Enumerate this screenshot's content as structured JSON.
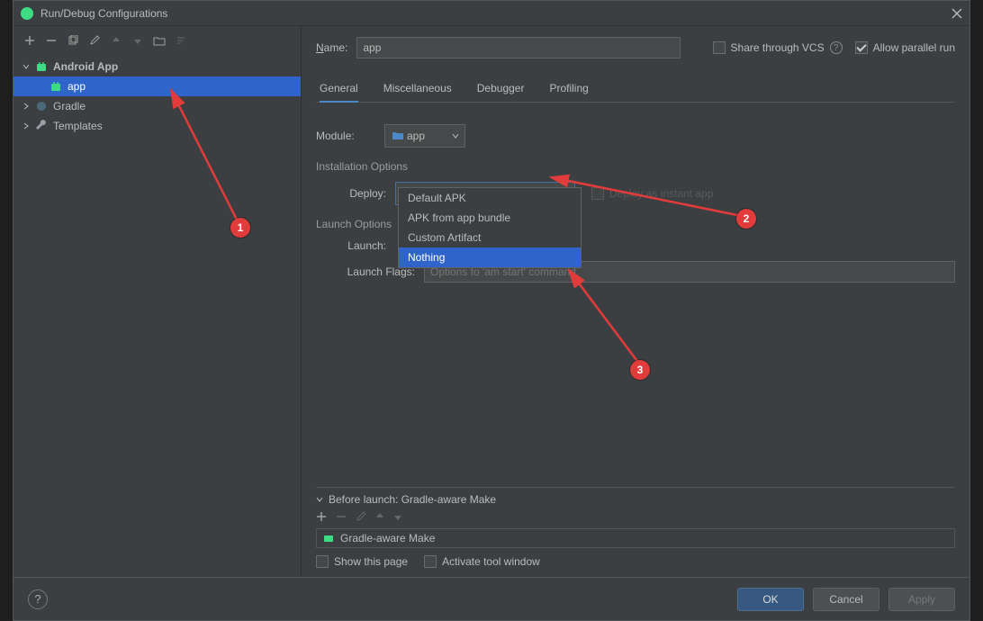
{
  "window": {
    "title": "Run/Debug Configurations"
  },
  "tree": {
    "android_app": "Android App",
    "app": "app",
    "gradle": "Gradle",
    "templates": "Templates"
  },
  "form": {
    "name_label_pre": "N",
    "name_label_post": "ame:",
    "name_value": "app",
    "share_label_pre": "S",
    "share_label_post": "hare through VCS",
    "allow_parallel_pre": "A",
    "allow_parallel_post": "llow parallel run"
  },
  "tabs": {
    "general": "General",
    "misc": "Miscellaneous",
    "debugger": "Debugger",
    "profiling": "Profiling"
  },
  "module_label_pre": "M",
  "module_label_post": "odule:",
  "module_value": "app",
  "install_section": "Installation Options",
  "deploy_label": "Deploy:",
  "deploy_selected": "Nothing",
  "deploy_options": {
    "o1": "Default APK",
    "o2": "APK from app bundle",
    "o3": "Custom Artifact",
    "o4": "Nothing"
  },
  "deploy_instant": "Deploy as instant app",
  "launch_section": "Launch Options",
  "launch_label": "Launch:",
  "launch_flags_label": "Launch Flags:",
  "launch_flags_placeholder": "Options to 'am start' command",
  "before_launch": {
    "header": "Before launch: Gradle-aware Make",
    "item": "Gradle-aware Make",
    "show_page": "Show this page",
    "activate_tool_pre": "A",
    "activate_tool_post": "ctivate tool window"
  },
  "footer": {
    "ok": "OK",
    "cancel": "Cancel",
    "apply": "Apply"
  },
  "markers": {
    "m1": "1",
    "m2": "2",
    "m3": "3"
  }
}
